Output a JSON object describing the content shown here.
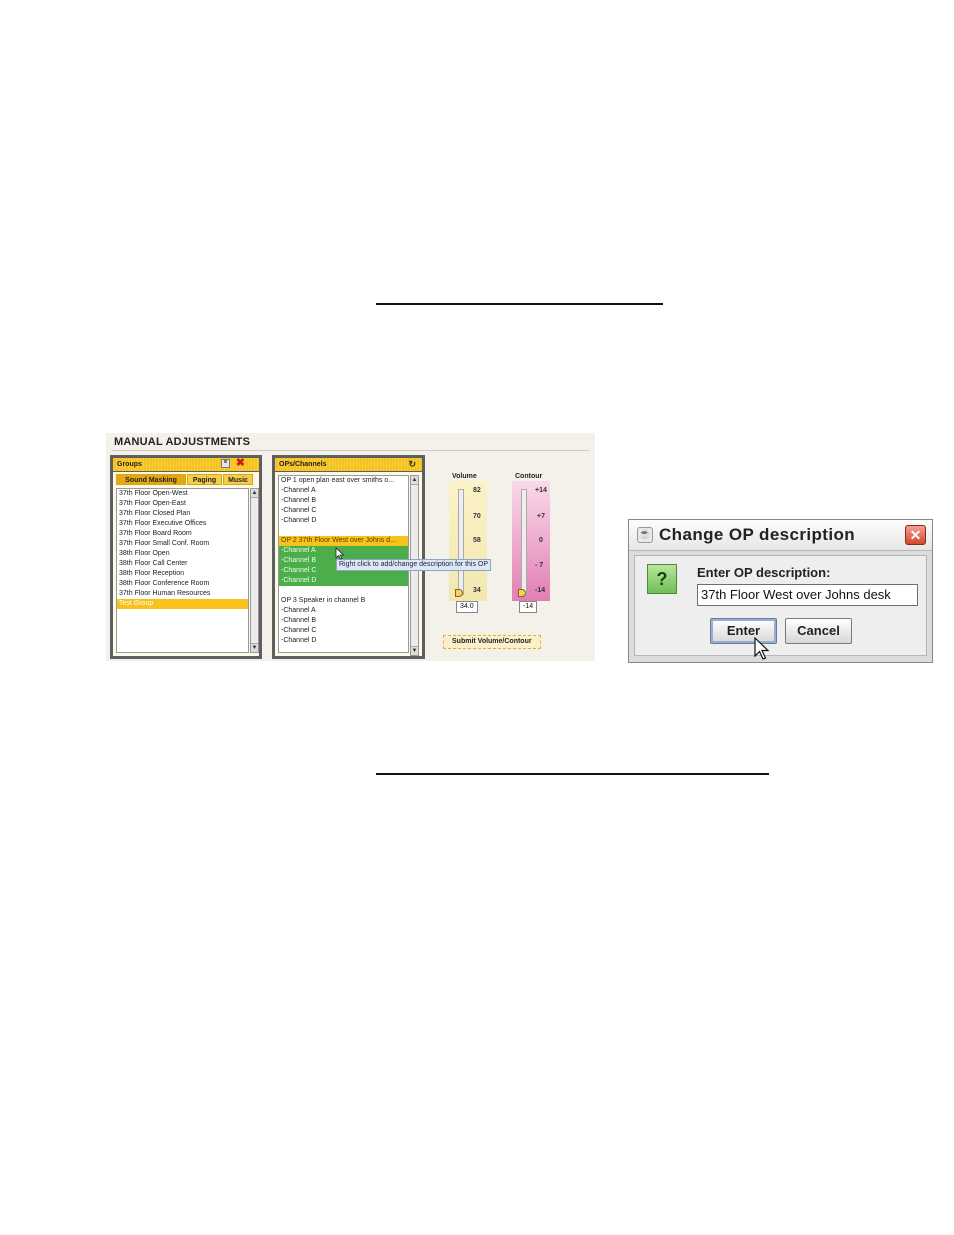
{
  "manual_adjustments": {
    "title": "MANUAL ADJUSTMENTS",
    "groups_panel": {
      "title": "Groups",
      "save_icon": "save-icon",
      "delete_icon": "red-x-icon",
      "tabs": [
        {
          "label": "Sound Masking",
          "active": true
        },
        {
          "label": "Paging",
          "active": false
        },
        {
          "label": "Music",
          "active": false
        }
      ],
      "items": [
        {
          "label": "37th Floor Open-West",
          "selected": false
        },
        {
          "label": "37th Floor Open-East",
          "selected": false
        },
        {
          "label": "37th Floor Closed Plan",
          "selected": false
        },
        {
          "label": "37th Floor Executive Offices",
          "selected": false
        },
        {
          "label": "37th Floor Board Room",
          "selected": false
        },
        {
          "label": "37th Floor Small Conf. Room",
          "selected": false
        },
        {
          "label": "38th Floor Open",
          "selected": false
        },
        {
          "label": "38th Floor Call Center",
          "selected": false
        },
        {
          "label": "38th Floor Reception",
          "selected": false
        },
        {
          "label": "38th Floor Conference Room",
          "selected": false
        },
        {
          "label": "37th Floor Human Resources",
          "selected": false
        },
        {
          "label": "Test Group",
          "selected": true
        }
      ]
    },
    "ops_panel": {
      "title": "OPs/Channels",
      "refresh_icon": "refresh-icon",
      "items": [
        {
          "label": "OP 1 open plan east over smiths o...",
          "state": "none"
        },
        {
          "label": "-Channel A",
          "state": "none"
        },
        {
          "label": "-Channel B",
          "state": "none"
        },
        {
          "label": "-Channel C",
          "state": "none"
        },
        {
          "label": "-Channel D",
          "state": "none"
        },
        {
          "label": "",
          "state": "gap"
        },
        {
          "label": "OP 2 37th Floor West over Johns d...",
          "state": "orange"
        },
        {
          "label": "-Channel A",
          "state": "green"
        },
        {
          "label": "-Channel B",
          "state": "green"
        },
        {
          "label": "-Channel C",
          "state": "green"
        },
        {
          "label": "-Channel D",
          "state": "green"
        },
        {
          "label": "",
          "state": "gap"
        },
        {
          "label": "OP 3 Speaker in channel B",
          "state": "none"
        },
        {
          "label": "-Channel A",
          "state": "none"
        },
        {
          "label": "-Channel B",
          "state": "none"
        },
        {
          "label": "-Channel C",
          "state": "none"
        },
        {
          "label": "-Channel D",
          "state": "none"
        }
      ],
      "tooltip": "Right click to add/change description for this OP"
    },
    "volume": {
      "label": "Volume",
      "ticks": [
        "82",
        "70",
        "58",
        "34"
      ],
      "value": "34.0"
    },
    "contour": {
      "label": "Contour",
      "ticks": [
        "+14",
        "+7",
        "0",
        "- 7",
        "-14"
      ],
      "value": "-14"
    },
    "submit_label": "Submit Volume/Contour"
  },
  "dialog": {
    "title": "Change OP description",
    "prompt": "Enter OP description:",
    "input_value": "37th Floor West over Johns desk",
    "enter_label": "Enter",
    "cancel_label": "Cancel",
    "close_glyph": "✕",
    "question_glyph": "?"
  }
}
